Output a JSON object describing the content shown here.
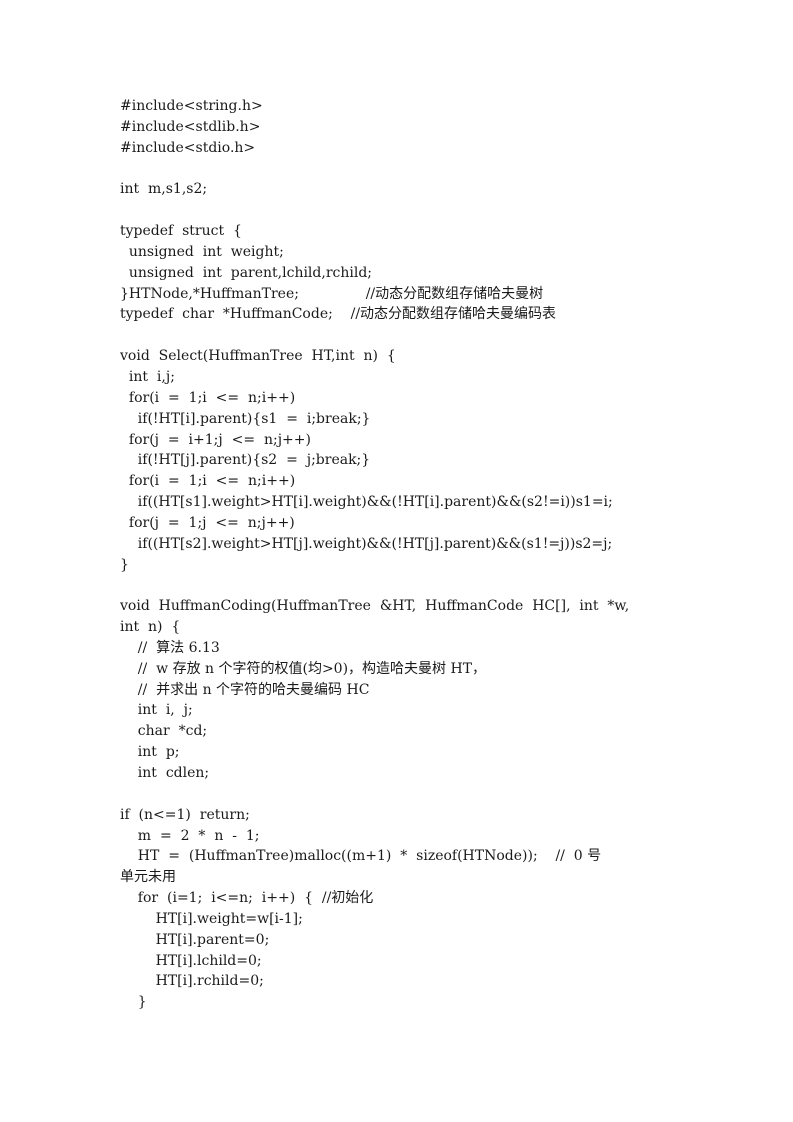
{
  "document": {
    "lines": [
      "#include<string.h>",
      "#include<stdlib.h>",
      "#include<stdio.h>",
      "",
      "int  m,s1,s2;",
      "",
      "typedef  struct  {",
      "  unsigned  int  weight;",
      "  unsigned  int  parent,lchild,rchild;",
      "}HTNode,*HuffmanTree;               //动态分配数组存储哈夫曼树",
      "typedef  char  *HuffmanCode;    //动态分配数组存储哈夫曼编码表",
      "",
      "void  Select(HuffmanTree  HT,int  n)  {",
      "  int  i,j;",
      "  for(i  =  1;i  <=  n;i++)",
      "    if(!HT[i].parent){s1  =  i;break;}",
      "  for(j  =  i+1;j  <=  n;j++)",
      "    if(!HT[j].parent){s2  =  j;break;}",
      "  for(i  =  1;i  <=  n;i++)",
      "    if((HT[s1].weight>HT[i].weight)&&(!HT[i].parent)&&(s2!=i))s1=i;",
      "  for(j  =  1;j  <=  n;j++)",
      "    if((HT[s2].weight>HT[j].weight)&&(!HT[j].parent)&&(s1!=j))s2=j;",
      "}",
      "",
      "void  HuffmanCoding(HuffmanTree  &HT,  HuffmanCode  HC[],  int  *w,",
      "int  n)  {",
      "    //  算法 6.13",
      "    //  w 存放 n 个字符的权值(均>0)，构造哈夫曼树 HT，",
      "    //  并求出 n 个字符的哈夫曼编码 HC",
      "    int  i,  j;",
      "    char  *cd;",
      "    int  p;",
      "    int  cdlen;",
      "",
      "if  (n<=1)  return;",
      "    m  =  2  *  n  -  1;",
      "    HT  =  (HuffmanTree)malloc((m+1)  *  sizeof(HTNode));    //  0 号",
      "单元未用",
      "    for  (i=1;  i<=n;  i++)  {  //初始化",
      "        HT[i].weight=w[i-1];",
      "        HT[i].parent=0;",
      "        HT[i].lchild=0;",
      "        HT[i].rchild=0;",
      "    }"
    ]
  }
}
